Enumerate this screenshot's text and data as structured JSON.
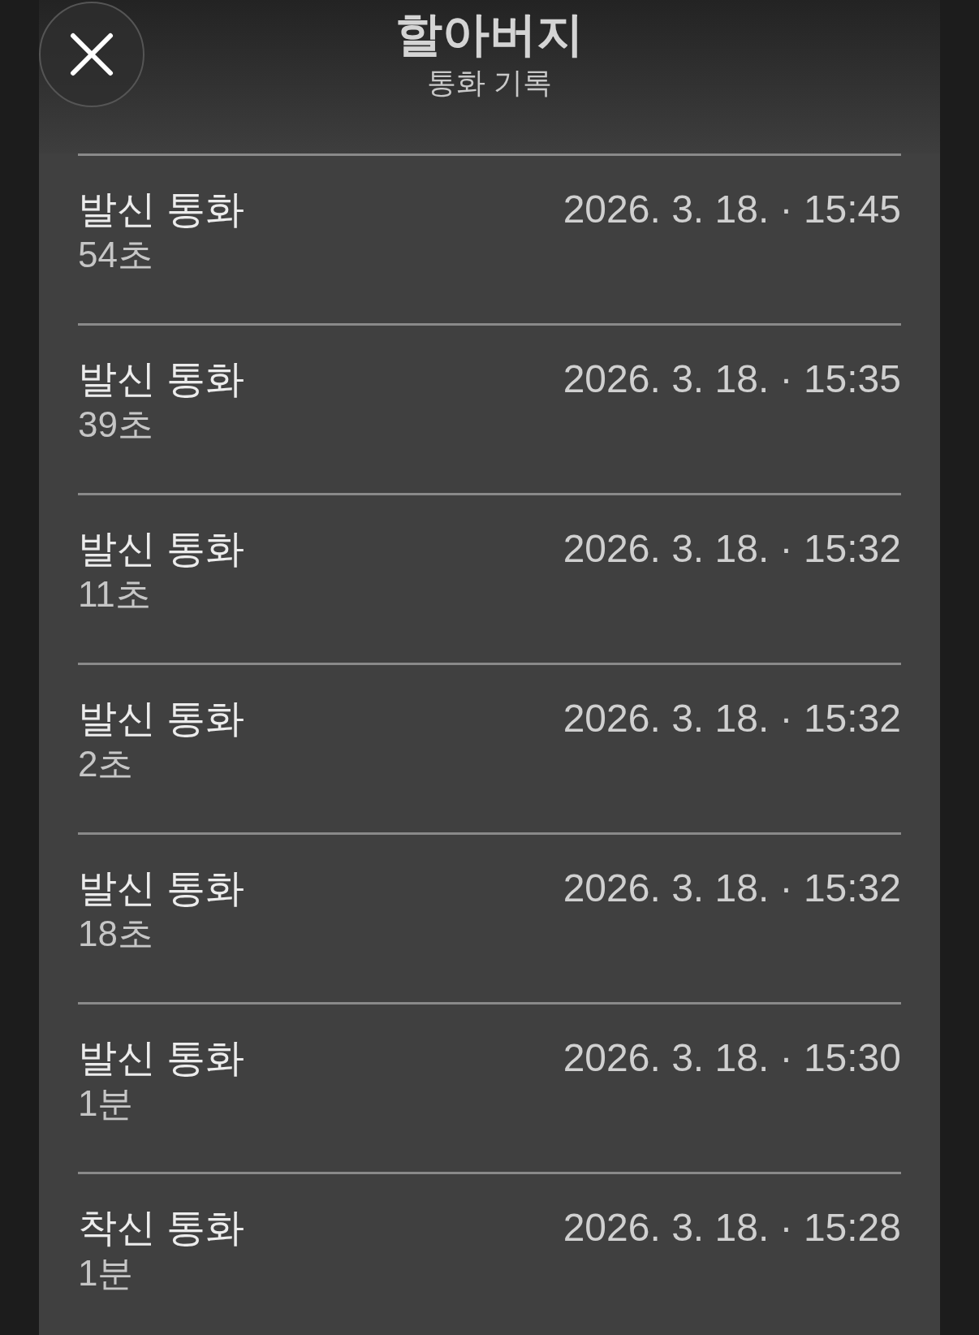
{
  "header": {
    "title": "할아버지",
    "subtitle": "통화 기록"
  },
  "calls": [
    {
      "type": "발신 통화",
      "duration": "54초",
      "time": "2026. 3. 18. · 15:45"
    },
    {
      "type": "발신 통화",
      "duration": "39초",
      "time": "2026. 3. 18. · 15:35"
    },
    {
      "type": "발신 통화",
      "duration": "11초",
      "time": "2026. 3. 18. · 15:32"
    },
    {
      "type": "발신 통화",
      "duration": "2초",
      "time": "2026. 3. 18. · 15:32"
    },
    {
      "type": "발신 통화",
      "duration": "18초",
      "time": "2026. 3. 18. · 15:32"
    },
    {
      "type": "발신 통화",
      "duration": "1분",
      "time": "2026. 3. 18. · 15:30"
    },
    {
      "type": "착신 통화",
      "duration": "1분",
      "time": "2026. 3. 18. · 15:28"
    }
  ]
}
